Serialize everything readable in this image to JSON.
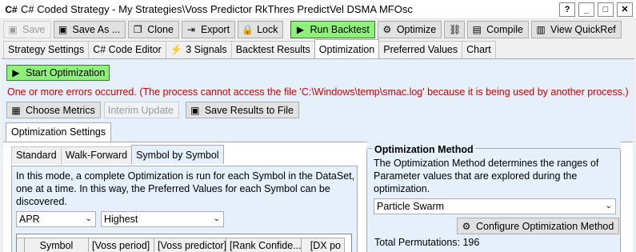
{
  "window": {
    "title": "C# Coded Strategy - My Strategies\\Voss Predictor RkThres PredictVel DSMA MFOsc",
    "buttons": [
      "?",
      "_",
      "□",
      "✕"
    ]
  },
  "toolbar": {
    "save": "Save",
    "save_as": "Save As ...",
    "clone": "Clone",
    "export": "Export",
    "lock": "Lock",
    "run_backtest": "Run Backtest",
    "optimize": "Optimize",
    "compile": "Compile",
    "view_quickref": "View QuickRef"
  },
  "tabs": [
    "Strategy Settings",
    "C# Code Editor",
    "3 Signals",
    "Backtest Results",
    "Optimization",
    "Preferred Values",
    "Chart"
  ],
  "optimization": {
    "start_label": "Start Optimization",
    "error": "One or more errors occurred. (The process cannot access the file 'C:\\Windows\\temp\\smac.log' because it is being used by another process.) (The...",
    "choose_metrics": "Choose Metrics",
    "interim_update": "Interim Update",
    "save_results": "Save Results to File",
    "settings_tab": "Optimization Settings"
  },
  "settings": {
    "tabs": [
      "Standard",
      "Walk-Forward",
      "Symbol by Symbol"
    ],
    "description": "In this mode, a complete Optimization is run for each Symbol in the DataSet, one at a time. In this way, the Preferred Values for each Symbol can be discovered.",
    "metric_select": "APR",
    "direction_select": "Highest",
    "grid_columns": [
      "Symbol",
      "[Voss period]",
      "[Voss predictor]",
      "[Rank Confide...",
      "[DX po"
    ]
  },
  "method": {
    "legend": "Optimization Method",
    "description": "The Optimization Method determines the ranges of Parameter values that are explored during the optimization.",
    "select": "Particle Swarm",
    "configure_label": "Configure Optimization Method",
    "permutations": "Total Permutations: 196"
  }
}
